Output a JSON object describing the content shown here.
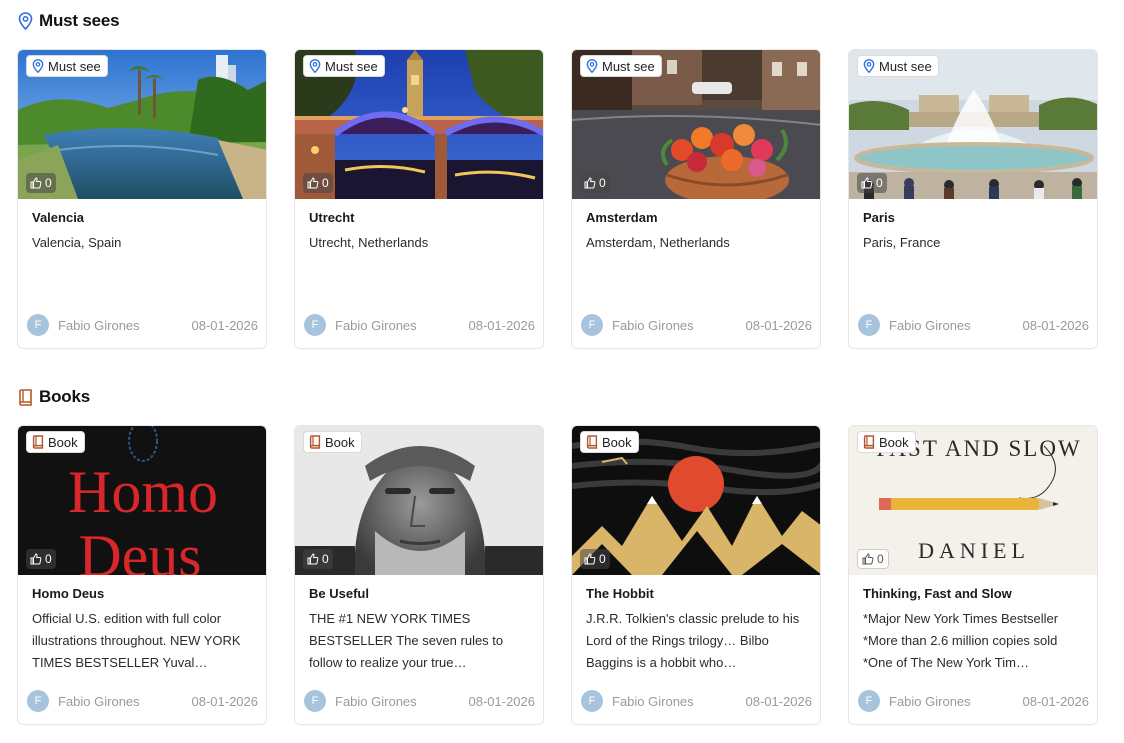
{
  "sections": [
    {
      "title": "Must sees",
      "icon": "map-pin-icon",
      "cards": [
        {
          "tag": "Must see",
          "likes": "0",
          "name": "Valencia",
          "description": "Valencia, Spain",
          "author_initial": "F",
          "author": "Fabio Girones",
          "date": "08-01-2026"
        },
        {
          "tag": "Must see",
          "likes": "0",
          "name": "Utrecht",
          "description": "Utrecht, Netherlands",
          "author_initial": "F",
          "author": "Fabio Girones",
          "date": "08-01-2026"
        },
        {
          "tag": "Must see",
          "likes": "0",
          "name": "Amsterdam",
          "description": "Amsterdam, Netherlands",
          "author_initial": "F",
          "author": "Fabio Girones",
          "date": "08-01-2026"
        },
        {
          "tag": "Must see",
          "likes": "0",
          "name": "Paris",
          "description": "Paris, France",
          "author_initial": "F",
          "author": "Fabio Girones",
          "date": "08-01-2026"
        }
      ]
    },
    {
      "title": "Books",
      "icon": "book-icon",
      "cards": [
        {
          "tag": "Book",
          "likes": "0",
          "name": "Homo Deus",
          "description": "Official U.S. edition with full color illustrations throughout. NEW YORK TIMES BESTSELLER Yuval…",
          "author_initial": "F",
          "author": "Fabio Girones",
          "date": "08-01-2026",
          "cover_text_1": "Homo",
          "cover_text_2": "Deus"
        },
        {
          "tag": "Book",
          "likes": "0",
          "name": "Be Useful",
          "description": "THE #1 NEW YORK TIMES BESTSELLER The seven rules to follow to realize your true…",
          "author_initial": "F",
          "author": "Fabio Girones",
          "date": "08-01-2026"
        },
        {
          "tag": "Book",
          "likes": "0",
          "name": "The Hobbit",
          "description": "J.R.R. Tolkien's classic prelude to his Lord of the Rings trilogy… Bilbo Baggins is a hobbit who…",
          "author_initial": "F",
          "author": "Fabio Girones",
          "date": "08-01-2026"
        },
        {
          "tag": "Book",
          "likes": "0",
          "name": "Thinking, Fast and Slow",
          "description": "*Major New York Times Bestseller *More than 2.6 million copies sold *One of The New York Tim…",
          "author_initial": "F",
          "author": "Fabio Girones",
          "date": "08-01-2026",
          "cover_text_1": "FAST AND SLOW",
          "cover_text_2": "DANIEL"
        }
      ]
    }
  ],
  "colors": {
    "pin": "#2f6fe0",
    "book": "#b5562a",
    "avatar": "#a7c4dc",
    "muted": "#9a9a9a"
  }
}
